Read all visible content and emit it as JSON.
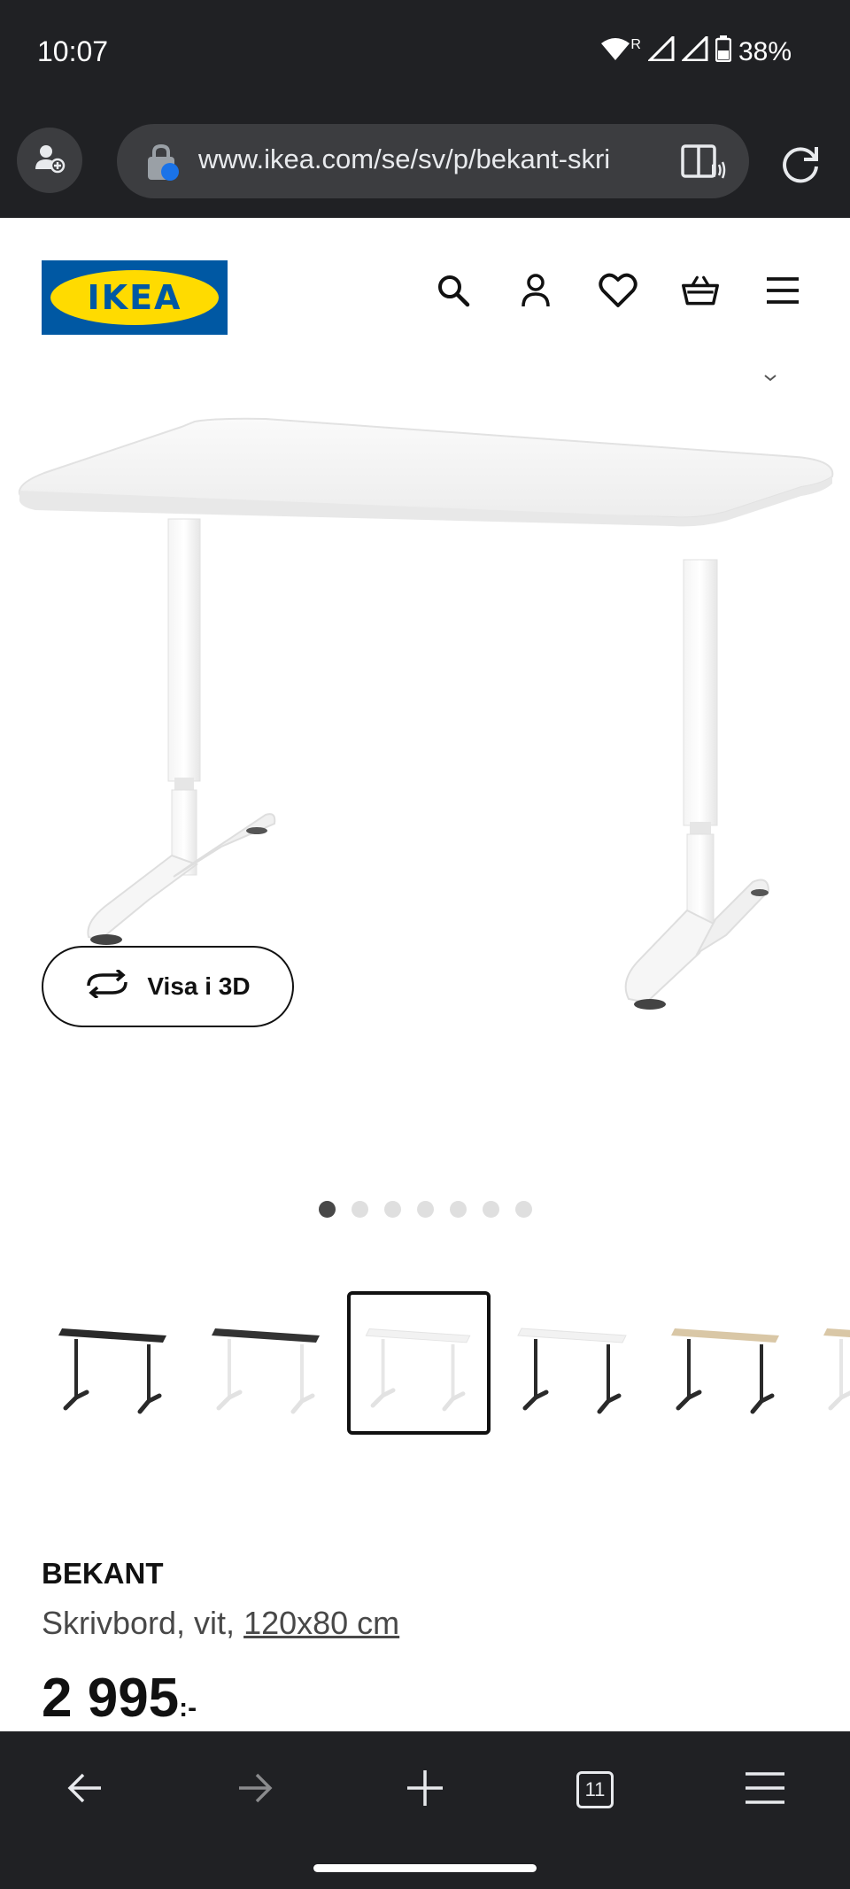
{
  "status": {
    "time": "10:07",
    "battery": "38%",
    "roaming": "R"
  },
  "browser": {
    "url": "www.ikea.com/se/sv/p/bekant-skri",
    "tab_count": "11"
  },
  "site": {
    "logo_text": "IKEA",
    "logo_color": "#0058a3",
    "logo_accent": "#ffdb00"
  },
  "header_icons": [
    "search-icon",
    "account-icon",
    "heart-icon",
    "basket-icon",
    "menu-icon"
  ],
  "hero": {
    "view_3d_label": "Visa i 3D",
    "dot_count": 7,
    "active_dot": 1
  },
  "thumbnails": [
    {
      "variant": "black-top-black-legs"
    },
    {
      "variant": "black-top-white-legs"
    },
    {
      "variant": "white-top-white-legs",
      "selected": true
    },
    {
      "variant": "white-top-black-legs"
    },
    {
      "variant": "oak-top-black-legs"
    },
    {
      "variant": "oak-top-white-legs"
    }
  ],
  "product": {
    "name": "BEKANT",
    "desc_prefix": "Skrivbord, vit, ",
    "size": "120x80 cm",
    "price": "2 995",
    "price_suffix": ":-"
  }
}
